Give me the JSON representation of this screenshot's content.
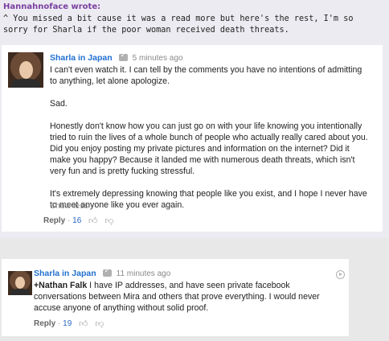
{
  "forum_post": {
    "author": "Hannahnoface wrote:",
    "text": "^ You missed a bit cause it was a read more but here's the rest, I'm so sorry for Sharla if the poor woman received death threats."
  },
  "comment1": {
    "author": "Sharla in Japan",
    "time": "5 minutes ago",
    "paragraphs": [
      "I can't even watch it. I can tell by the comments you have no intentions of admitting to anything, let alone apologize.",
      "Sad.",
      "Honestly don't know how you can just go on with your life knowing you intentionally tried to ruin the lives of a whole bunch of people who actually really cared about you. Did you enjoy posting my private pictures and information on the internet? Did it make you happy? Because it landed me with numerous death threats, which isn't very fun and is pretty fucking stressful.",
      "It's extremely depressing knowing that people like you exist, and I hope I never have to meet anyone like you ever again."
    ],
    "show_less": "Show less",
    "reply": "Reply",
    "separator": "·",
    "likes": "16"
  },
  "comment2": {
    "author": "Sharla in Japan",
    "time": "11 minutes ago",
    "mention": "+Nathan Falk",
    "text": " I have IP addresses, and  have seen private facebook conversations between Mira and others that prove everything. I would never accuse anyone of anything without solid proof.",
    "reply": "Reply",
    "separator": "·",
    "likes": "19"
  },
  "icons": [
    "verified-badge-icon",
    "thumbs-up-icon",
    "thumbs-down-icon",
    "more-options-icon"
  ]
}
